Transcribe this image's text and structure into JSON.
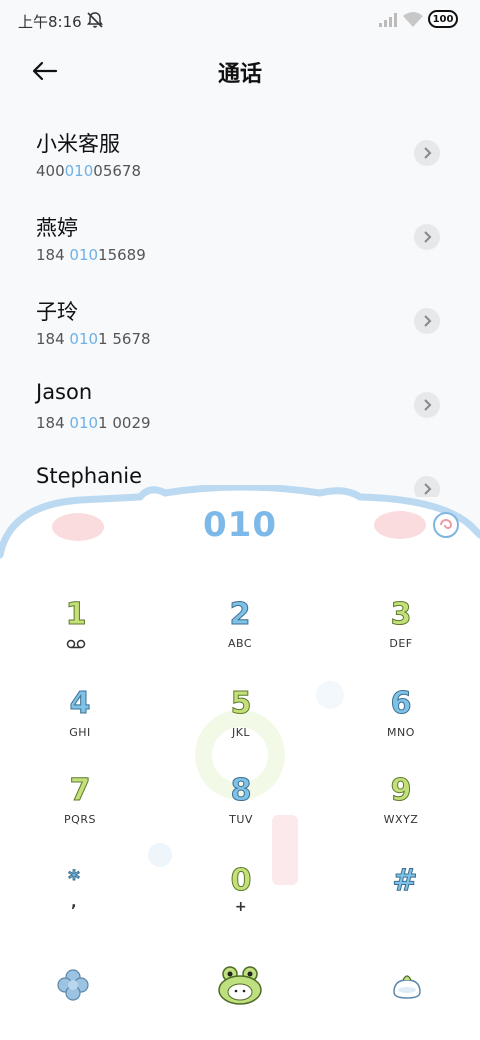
{
  "status": {
    "time": "上午8:16",
    "battery": "100"
  },
  "header": {
    "title": "通话"
  },
  "results": [
    {
      "name": "小米客服",
      "number_pre": "400",
      "number_hl": "010",
      "number_post": "05678"
    },
    {
      "name": "燕婷",
      "number_pre": "184 ",
      "number_hl": "010",
      "number_post": "15689"
    },
    {
      "name": "子玲",
      "number_pre": "184 ",
      "number_hl": "010",
      "number_post": "1 5678"
    },
    {
      "name": "Jason",
      "number_pre": "184 ",
      "number_hl": "010",
      "number_post": "1 0029"
    },
    {
      "name": "Stephanie",
      "number_pre": "",
      "number_hl": "",
      "number_post": ""
    }
  ],
  "dialpad": {
    "display": "010",
    "keys": [
      {
        "digit": "1",
        "letters": ""
      },
      {
        "digit": "2",
        "letters": "ABC"
      },
      {
        "digit": "3",
        "letters": "DEF"
      },
      {
        "digit": "4",
        "letters": "GHI"
      },
      {
        "digit": "5",
        "letters": "JKL"
      },
      {
        "digit": "6",
        "letters": "MNO"
      },
      {
        "digit": "7",
        "letters": "PQRS"
      },
      {
        "digit": "8",
        "letters": "TUV"
      },
      {
        "digit": "9",
        "letters": "WXYZ"
      },
      {
        "digit": "*",
        "letters": ","
      },
      {
        "digit": "0",
        "letters": "+"
      },
      {
        "digit": "#",
        "letters": ""
      }
    ]
  },
  "icons": {
    "back": "arrow-left-icon",
    "detail": "chevron-right-icon",
    "menu": "flower-menu-icon",
    "call": "frog-call-icon",
    "hide": "bun-hide-icon"
  },
  "colors": {
    "accent": "#6fb0e6",
    "digit_blue": "#7fc2e8",
    "digit_green": "#c5e07a"
  }
}
